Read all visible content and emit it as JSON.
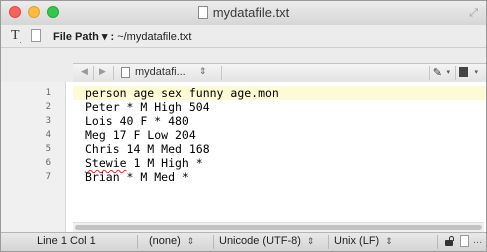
{
  "window": {
    "title": "mydatafile.txt"
  },
  "pathbar": {
    "label": "File Path ▾ :",
    "path": "~/mydatafile.txt"
  },
  "editor_header": {
    "back_glyph": "◀",
    "forward_glyph": "▶",
    "filename": "mydatafi...",
    "select_glyph": "⇕"
  },
  "editor": {
    "current_line": 1,
    "lines": [
      {
        "number": "1",
        "text": "person age sex funny age.mon"
      },
      {
        "number": "2",
        "text": "Peter * M High 504"
      },
      {
        "number": "3",
        "text": "Lois 40 F * 480"
      },
      {
        "number": "4",
        "text": "Meg 17 F Low 204"
      },
      {
        "number": "5",
        "text": "Chris 14 M Med 168"
      },
      {
        "number": "6",
        "text_misspelled": "Stewie",
        "text_rest": " 1 M High *"
      },
      {
        "number": "7",
        "text": "Brian * M Med *"
      }
    ]
  },
  "statusbar": {
    "position": "Line 1 Col 1",
    "syntax": "(none)",
    "encoding": "Unicode (UTF-8)",
    "line_endings": "Unix (LF)",
    "select_glyph": "⇕",
    "more": "..."
  },
  "icons": {
    "text_tool": "T",
    "pen": "✎",
    "caret": "▾",
    "fullscreen": "⤢"
  },
  "colors": {
    "current_line_bg": "#fdfbd6",
    "spell_error": "#e0312f",
    "close": "#fc605c",
    "minimize": "#fdbc40",
    "zoom": "#34c84a"
  }
}
